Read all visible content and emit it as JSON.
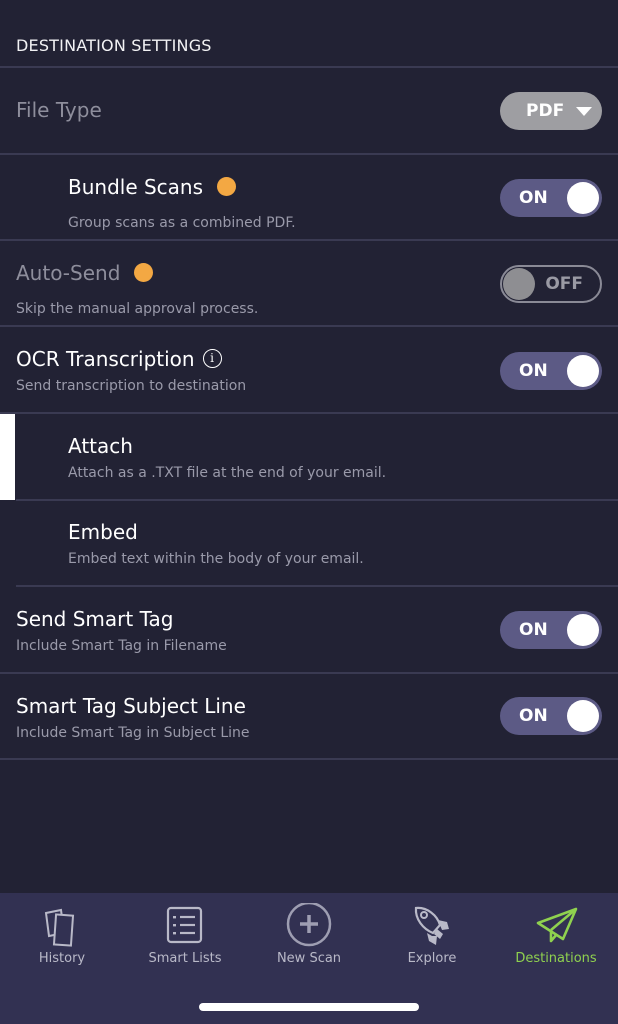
{
  "section": {
    "title": "DESTINATION SETTINGS"
  },
  "file_type": {
    "label": "File Type",
    "value": "PDF"
  },
  "bundle_scans": {
    "title": "Bundle Scans",
    "subtitle": "Group scans as a combined PDF.",
    "state": "ON",
    "has_badge": true
  },
  "auto_send": {
    "title": "Auto-Send",
    "subtitle": "Skip the manual approval process.",
    "state": "OFF",
    "has_badge": true
  },
  "ocr": {
    "title": "OCR Transcription",
    "subtitle": "Send transcription to destination",
    "state": "ON",
    "info_icon": "i"
  },
  "attach": {
    "title": "Attach",
    "subtitle": "Attach as a .TXT file at the end of your email.",
    "selected": true
  },
  "embed": {
    "title": "Embed",
    "subtitle": "Embed text within the body of your email.",
    "selected": false
  },
  "send_smart_tag": {
    "title": "Send Smart Tag",
    "subtitle": "Include Smart Tag in Filename",
    "state": "ON"
  },
  "smart_tag_subject": {
    "title": "Smart Tag Subject Line",
    "subtitle": "Include Smart Tag in Subject Line",
    "state": "ON"
  },
  "tabbar": {
    "tabs": [
      {
        "label": "History",
        "icon": "history-icon"
      },
      {
        "label": "Smart Lists",
        "icon": "list-icon"
      },
      {
        "label": "New Scan",
        "icon": "plus-circle-icon"
      },
      {
        "label": "Explore",
        "icon": "rocket-icon"
      },
      {
        "label": "Destinations",
        "icon": "paper-plane-icon",
        "active": true
      }
    ]
  },
  "colors": {
    "background": "#222234",
    "tabbar": "#323152",
    "toggle_on": "#5c5a85",
    "badge": "#f3a843",
    "active_tab": "#8fd14f"
  }
}
